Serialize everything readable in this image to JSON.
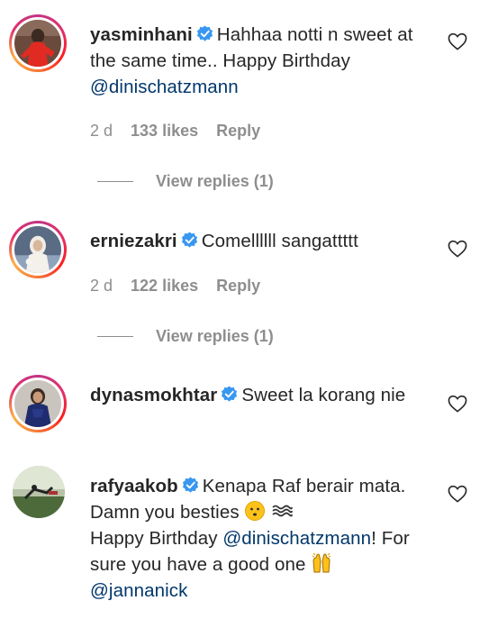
{
  "comments": [
    {
      "username": "yasminhani",
      "text_parts": [
        "Hahhaa notti n sweet at the same time.. Happy Birthday "
      ],
      "mention": "@dinischatzmann",
      "age": "2 d",
      "likes": "133 likes",
      "reply": "Reply",
      "view_replies": "View replies (1)"
    },
    {
      "username": "erniezakri",
      "text": "Comellllll sangattttt",
      "age": "2 d",
      "likes": "122 likes",
      "reply": "Reply",
      "view_replies": "View replies (1)"
    },
    {
      "username": "dynasmokhtar",
      "text": "Sweet la korang nie"
    },
    {
      "username": "rafyaakob",
      "text_a": "Kenapa Raf berair mata. Damn you besties ",
      "text_b": "Happy Birthday ",
      "mention_a": "@dinischatzmann",
      "text_c": "! For sure you have a good one ",
      "mention_b": "@jannanick"
    }
  ],
  "icons": {
    "verified": "verified-badge-icon",
    "like": "heart-outline-icon",
    "emoji_face": "hushed-face-emoji",
    "emoji_wave": "wave-emoji",
    "emoji_raised_hands": "raised-hands-emoji"
  },
  "colors": {
    "verified": "#3897f0",
    "mention": "#00376b",
    "meta": "#8e8e8e",
    "text": "#262626"
  }
}
